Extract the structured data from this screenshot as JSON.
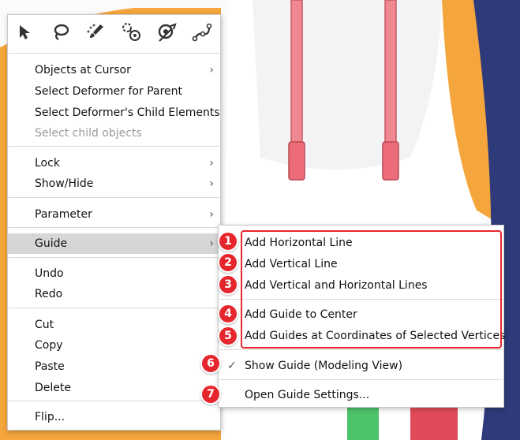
{
  "toolbar": {
    "icons": [
      "arrow-select-icon",
      "lasso-icon",
      "brush-select-icon",
      "deformer-connect-icon",
      "deformer-select-icon",
      "path-curve-icon"
    ]
  },
  "menu": {
    "objects_at_cursor": "Objects at Cursor",
    "select_deformer_parent": "Select Deformer for Parent",
    "select_deformer_children": "Select Deformer's Child Elements",
    "select_child_objects": "Select child objects",
    "lock": "Lock",
    "show_hide": "Show/Hide",
    "parameter": "Parameter",
    "guide": "Guide",
    "undo": "Undo",
    "redo": "Redo",
    "cut": "Cut",
    "copy": "Copy",
    "paste": "Paste",
    "delete": "Delete",
    "flip": "Flip..."
  },
  "submenu": {
    "add_horizontal": "Add Horizontal Line",
    "add_vertical": "Add Vertical Line",
    "add_both": "Add Vertical and Horizontal Lines",
    "add_center": "Add Guide to Center",
    "add_coords": "Add Guides at Coordinates of Selected Vertices",
    "show_guide": "Show Guide (Modeling View)",
    "open_settings": "Open Guide Settings..."
  },
  "badges": [
    "1",
    "2",
    "3",
    "4",
    "5",
    "6",
    "7"
  ],
  "colors": {
    "highlight_red": "#e5262d",
    "active_item_bg": "#d6d6d6",
    "disabled_text": "#9a9a9a"
  }
}
